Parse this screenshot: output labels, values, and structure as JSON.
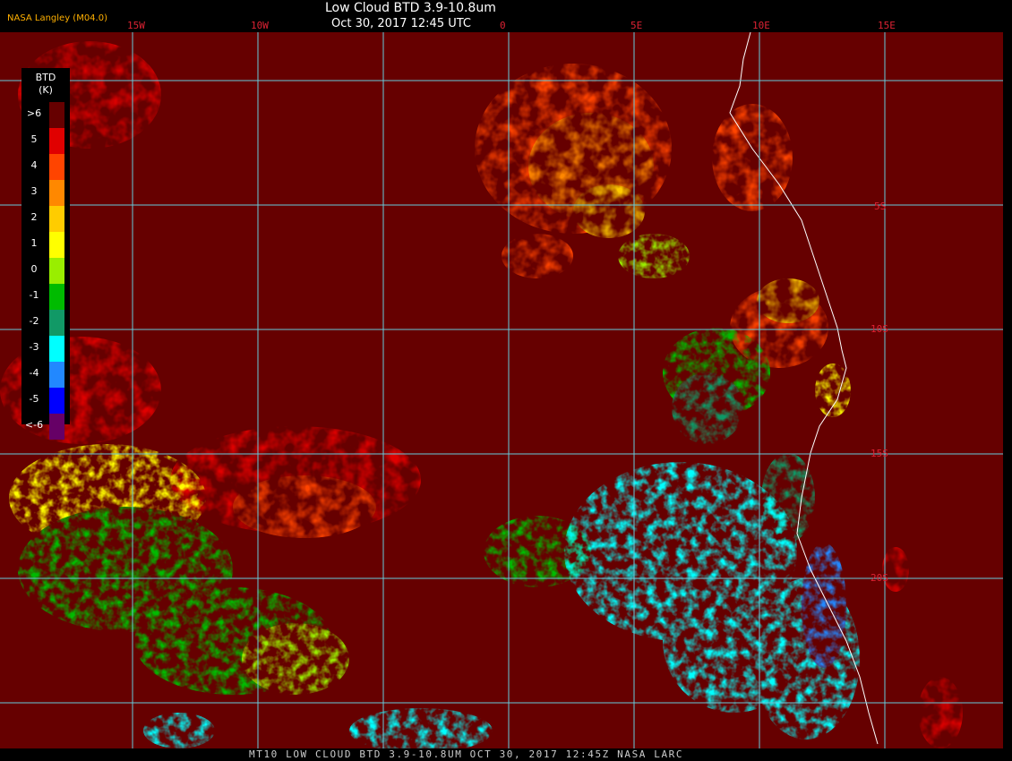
{
  "header": {
    "title": "Low Cloud BTD 3.9-10.8um",
    "subtitle": "Oct 30, 2017 12:45 UTC",
    "credit": "NASA Langley (M04.0)"
  },
  "legend": {
    "title_line1": "BTD",
    "title_line2": "(K)",
    "entries": [
      {
        "label": ">6",
        "color": "#660000"
      },
      {
        "label": "5",
        "color": "#e00000"
      },
      {
        "label": "4",
        "color": "#ff4400"
      },
      {
        "label": "3",
        "color": "#ff8800"
      },
      {
        "label": "2",
        "color": "#ffcc00"
      },
      {
        "label": "1",
        "color": "#ffff00"
      },
      {
        "label": "0",
        "color": "#99ee00"
      },
      {
        "label": "-1",
        "color": "#00bb00"
      },
      {
        "label": "-2",
        "color": "#119966"
      },
      {
        "label": "-3",
        "color": "#00ffff"
      },
      {
        "label": "-4",
        "color": "#2288ff"
      },
      {
        "label": "-5",
        "color": "#0000ff"
      },
      {
        "label": "<-6",
        "color": "#660066"
      }
    ]
  },
  "grid": {
    "lon_labels": [
      "15W",
      "10W",
      "0",
      "5E",
      "10E",
      "15E"
    ],
    "lat_labels": [
      "5S",
      "10S",
      "15S",
      "20S"
    ],
    "line_color": "#66ccdd"
  },
  "footer": {
    "text": "MT10  LOW CLOUD BTD 3.9-10.8UM   OCT 30, 2017 12:45Z  NASA LARC"
  }
}
